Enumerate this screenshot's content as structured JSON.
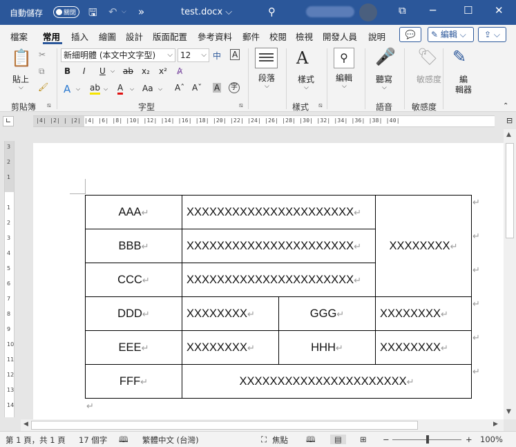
{
  "titlebar": {
    "autosave_label": "自動儲存",
    "autosave_state": "關閉",
    "doc_title": "test.docx ⌵",
    "save_icon": "save-icon",
    "undo_icon": "undo-icon",
    "redo_icon": "redo-icon",
    "more_icon": "»",
    "search_icon": "search-icon"
  },
  "tabs": [
    "檔案",
    "常用",
    "插入",
    "繪圖",
    "設計",
    "版面配置",
    "參考資料",
    "郵件",
    "校閱",
    "檢視",
    "開發人員",
    "說明"
  ],
  "active_tab": "常用",
  "header_buttons": {
    "comment": "💬",
    "edit": "✎ 編輯 ⌵",
    "share": "⇪ ⌵"
  },
  "ribbon": {
    "clipboard": {
      "paste": "貼上",
      "group": "剪貼簿"
    },
    "font": {
      "font_name": "新細明體 (本文中文字型)",
      "font_size": "12",
      "group": "字型",
      "bold": "B",
      "italic": "I",
      "underline": "U",
      "strike": "ab",
      "subscript": "x₂",
      "superscript": "x²",
      "grow": "A^",
      "shrink": "A˅",
      "case": "Aa",
      "phonetic": "中",
      "char_border": "A",
      "char_shade": "A",
      "enclose": "字"
    },
    "paragraph": {
      "label": "段落",
      "group": ""
    },
    "styles": {
      "label": "樣式",
      "group": "樣式"
    },
    "editing": {
      "label": "編輯"
    },
    "voice": {
      "label": "聽寫",
      "group": "語音"
    },
    "sensitivity": {
      "label": "敏感度",
      "group": "敏感度"
    },
    "editor": {
      "label1": "編",
      "label2": "輯器"
    }
  },
  "ruler": {
    "ticks": "|4| |2| | |2| |4| |6| |8| |10| |12| |14| |16| |18| |20| |22| |24| |26| |28| |30| |32| |34| |36| |38| |40|",
    "vticks": [
      "3",
      "2",
      "1",
      "",
      "1",
      "2",
      "3",
      "4",
      "5",
      "6",
      "7",
      "8",
      "9",
      "10",
      "11",
      "12",
      "13",
      "14"
    ]
  },
  "table": {
    "rows": [
      [
        "AAA",
        "XXXXXXXXXXXXXXXXXXXXXX",
        "XXXXXXXX"
      ],
      [
        "BBB",
        "XXXXXXXXXXXXXXXXXXXXXX"
      ],
      [
        "CCC",
        "XXXXXXXXXXXXXXXXXXXXXX"
      ],
      [
        "DDD",
        "XXXXXXXX",
        "GGG",
        "XXXXXXXX"
      ],
      [
        "EEE",
        "XXXXXXXX",
        "HHH",
        "XXXXXXXX"
      ],
      [
        "FFF",
        "XXXXXXXXXXXXXXXXXXXXXX"
      ]
    ],
    "cell_mark": "↵",
    "row_mark": "↵"
  },
  "statusbar": {
    "page": "第 1 頁，共 1 頁",
    "words": "17 個字",
    "proof_icon": "book-icon",
    "language": "繁體中文 (台灣)",
    "focus": "焦點",
    "zoom": "100%",
    "zoom_level": 1.0
  }
}
